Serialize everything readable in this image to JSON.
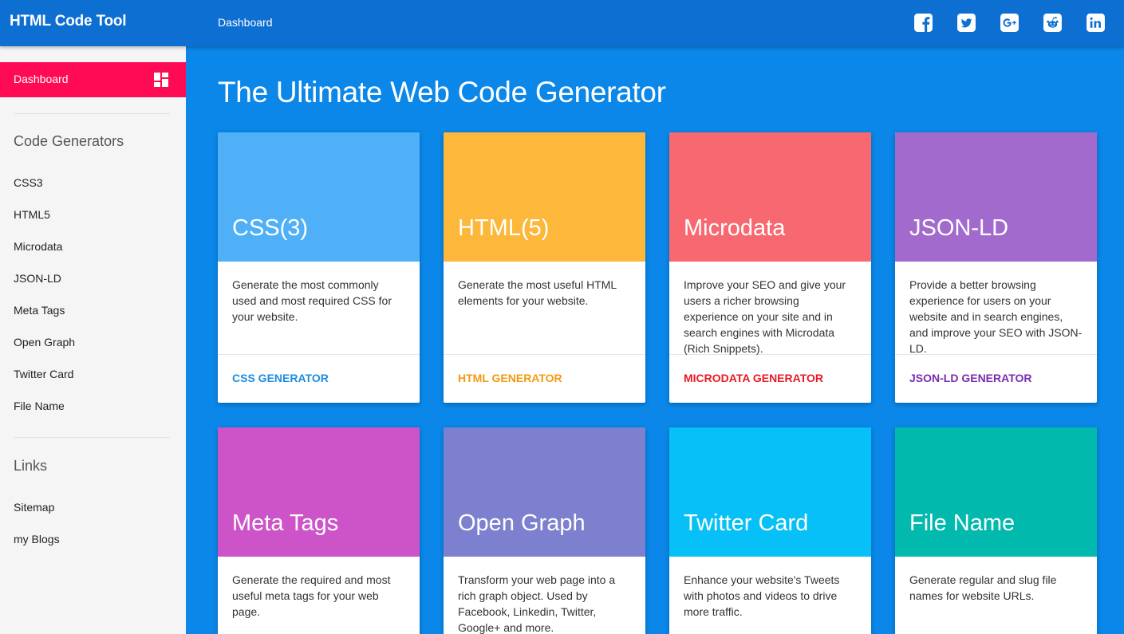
{
  "header": {
    "app_title": "HTML Code Tool",
    "breadcrumb": "Dashboard",
    "social": [
      "facebook-icon",
      "twitter-icon",
      "google-plus-icon",
      "reddit-icon",
      "linkedin-icon"
    ]
  },
  "sidebar": {
    "active_item": "Dashboard",
    "active_icon": "dashboard-grid-icon",
    "generators_heading": "Code Generators",
    "generators": [
      "CSS3",
      "HTML5",
      "Microdata",
      "JSON-LD",
      "Meta Tags",
      "Open Graph",
      "Twitter Card",
      "File Name"
    ],
    "links_heading": "Links",
    "links": [
      "Sitemap",
      "my Blogs"
    ]
  },
  "main": {
    "title": "The Ultimate Web Code Generator",
    "cards": [
      {
        "title": "CSS(3)",
        "desc": "Generate the most commonly used and most required CSS for your website.",
        "action": "CSS GENERATOR",
        "color": "#4fb0f7",
        "action_color": "#1c8ddf"
      },
      {
        "title": "HTML(5)",
        "desc": "Generate the most useful HTML elements for your website.",
        "action": "HTML GENERATOR",
        "color": "#fdb73a",
        "action_color": "#f3990e"
      },
      {
        "title": "Microdata",
        "desc": "Improve your SEO and give your users a richer browsing experience on your site and in search engines with Microdata (Rich Snippets).",
        "action": "MICRODATA GENERATOR",
        "color": "#f76870",
        "action_color": "#e81a24"
      },
      {
        "title": "JSON-LD",
        "desc": "Provide a better browsing experience for users on your website and in search engines, and improve your SEO with JSON-LD.",
        "action": "JSON-LD GENERATOR",
        "color": "#a26acd",
        "action_color": "#7a2bb0"
      },
      {
        "title": "Meta Tags",
        "desc": "Generate the required and most useful meta tags for your web page.",
        "action": "",
        "color": "#cd53c9",
        "action_color": "#b02aab"
      },
      {
        "title": "Open Graph",
        "desc": "Transform your web page into a rich graph object. Used by Facebook, Linkedin, Twitter, Google+ and more.",
        "action": "",
        "color": "#7d80cf",
        "action_color": "#4f53b5"
      },
      {
        "title": "Twitter Card",
        "desc": "Enhance your website's Tweets with photos and videos to drive more traffic.",
        "action": "",
        "color": "#07c0f7",
        "action_color": "#0592c9"
      },
      {
        "title": "File Name",
        "desc": "Generate regular and slug file names for website URLs.",
        "action": "",
        "color": "#02b9ad",
        "action_color": "#028c83"
      }
    ]
  }
}
